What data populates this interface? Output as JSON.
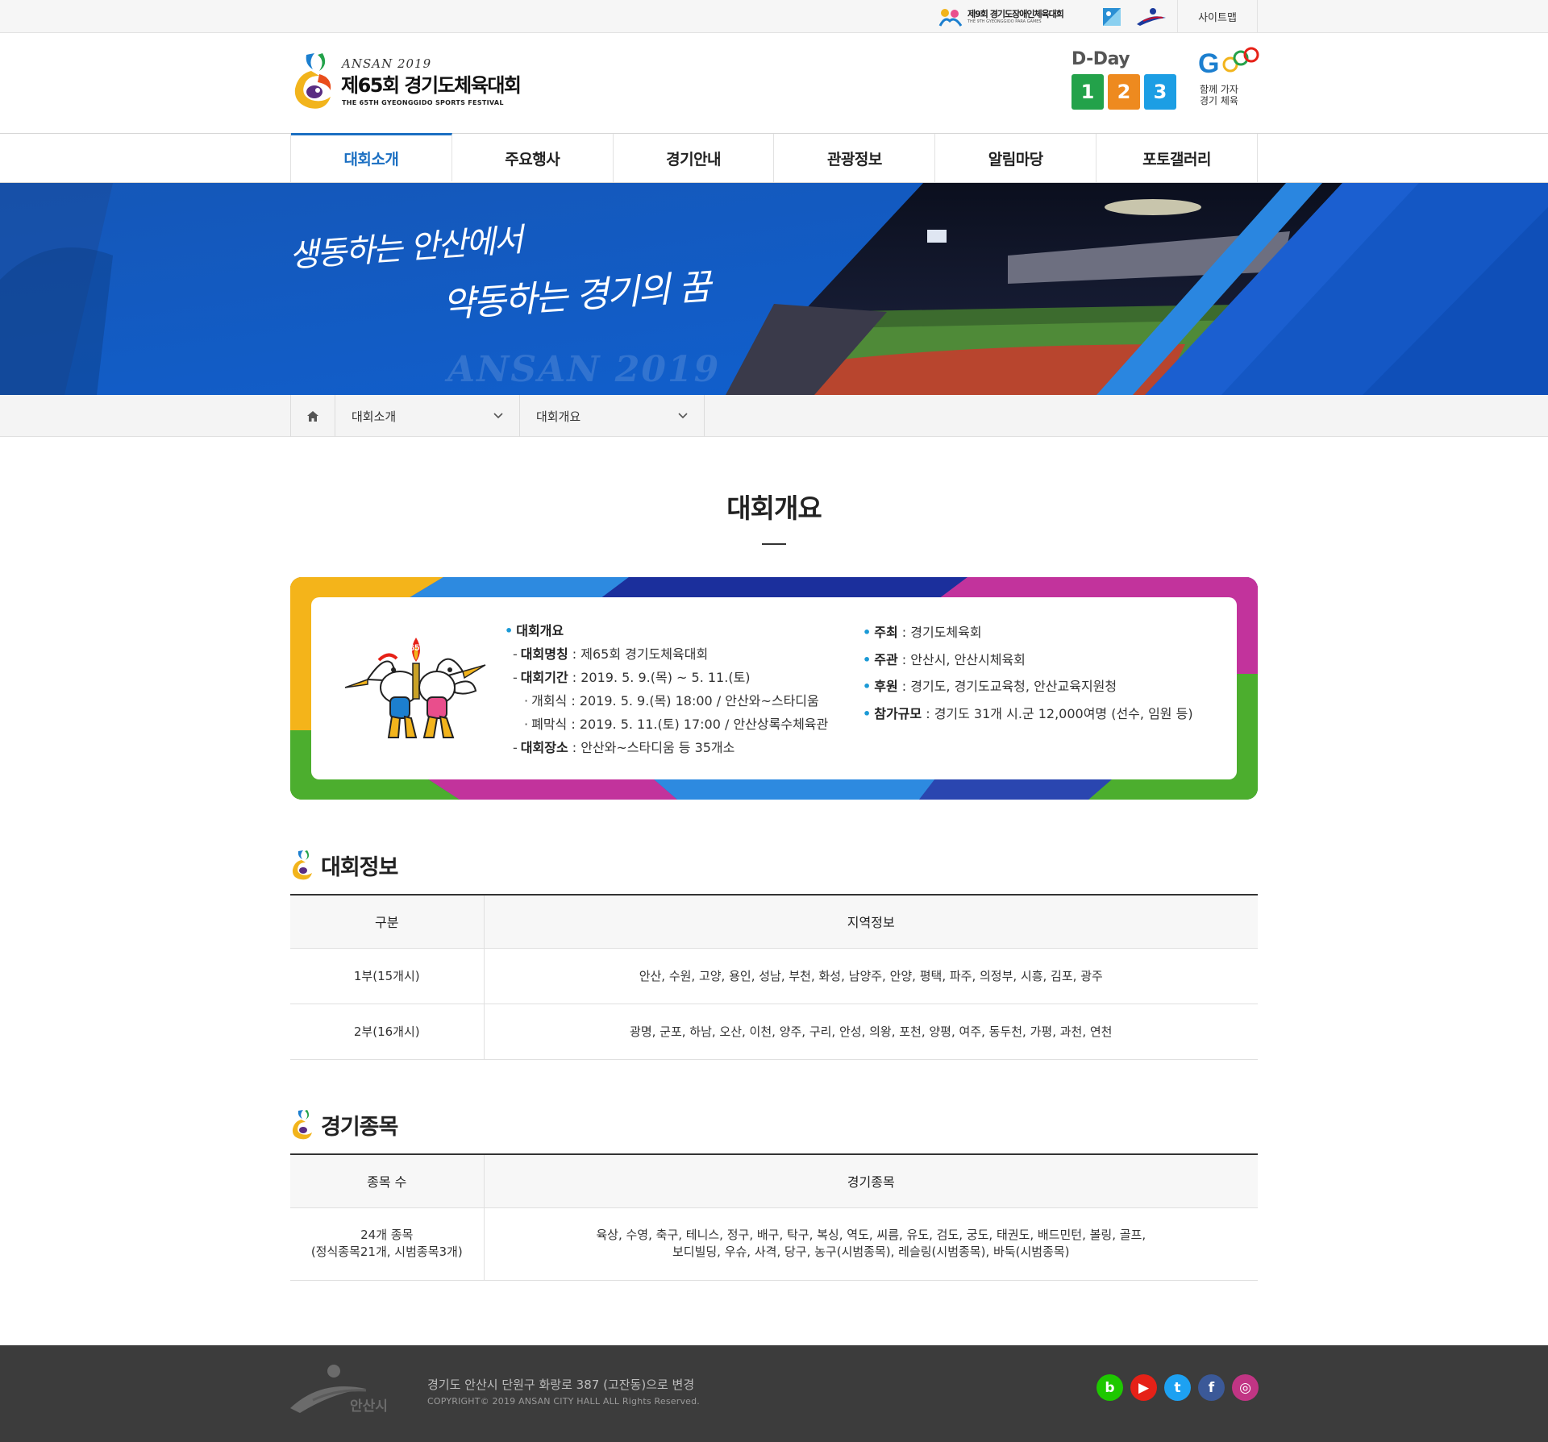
{
  "topbar": {
    "para_games_title": "제9회 경기도장애인체육대회",
    "para_games_subtitle": "THE 9TH GYEONGGIDO PARA GAMES",
    "sitemap_label": "사이트맵"
  },
  "header": {
    "logo_year": "ANSAN 2019",
    "logo_title": "제65회 경기도체육대회",
    "logo_subtitle": "THE 65TH GYEONGGIDO SPORTS FESTIVAL",
    "dday_label": "D-Day",
    "dday_digits": [
      "1",
      "2",
      "3"
    ],
    "dday_colors": [
      "#23a24a",
      "#ee8a1f",
      "#1c9ee4"
    ],
    "go_logo": "GO",
    "go_slogan_line1": "함께 가자",
    "go_slogan_line2": "경기 체육"
  },
  "nav": {
    "items": [
      "대회소개",
      "주요행사",
      "경기안내",
      "관광정보",
      "알림마당",
      "포토갤러리"
    ],
    "active_index": 0,
    "accent_color": "#1b6fc2"
  },
  "hero": {
    "slogan_line1": "생동하는 안산에서",
    "slogan_line2": "약동하는 경기의 꿈",
    "watermark": "ANSAN 2019"
  },
  "breadcrumb": {
    "home_icon": "home-icon",
    "level1": "대회소개",
    "level2": "대회개요"
  },
  "page_title": "대회개요",
  "overview": {
    "heading": "대회개요",
    "name_label": "대회명칭",
    "name_value": " : 제65회 경기도체육대회",
    "period_label": "대회기간",
    "period_value": " : 2019. 5. 9.(목) ~ 5. 11.(토)",
    "opening": "개회식 : 2019. 5. 9.(목) 18:00 / 안산와~스타디움",
    "closing": "폐막식 : 2019. 5. 11.(토) 17:00 / 안산상록수체육관",
    "venue_label": "대회장소",
    "venue_value": " : 안산와~스타디움 등 35개소",
    "host_label": "주최",
    "host_value": " : 경기도체육회",
    "organizer_label": "주관",
    "organizer_value": " : 안산시, 안산시체육회",
    "sponsor_label": "후원",
    "sponsor_value": " : 경기도, 경기도교육청, 안산교육지원청",
    "scale_label": "참가규모",
    "scale_value": " : 경기도 31개 시.군 12,000여명 (선수, 임원 등)"
  },
  "info_section": {
    "title": "대회정보",
    "headers": [
      "구분",
      "지역정보"
    ],
    "rows": [
      [
        "1부(15개시)",
        "안산, 수원, 고양, 용인, 성남, 부천, 화성, 남양주, 안양, 평택, 파주, 의정부, 시흥, 김포, 광주"
      ],
      [
        "2부(16개시)",
        "광명, 군포, 하남, 오산, 이천, 양주, 구리, 안성, 의왕, 포천, 양평, 여주, 동두천, 가평, 과천, 연천"
      ]
    ]
  },
  "sports_section": {
    "title": "경기종목",
    "headers": [
      "종목 수",
      "경기종목"
    ],
    "count_line1": "24개 종목",
    "count_line2": "(정식종목21개, 시범종목3개)",
    "sports_line1": "육상, 수영, 축구, 테니스, 정구, 배구, 탁구, 복싱, 역도, 씨름, 유도, 검도, 궁도, 태권도, 배드민턴, 볼링, 골프,",
    "sports_line2": "보디빌딩, 우슈, 사격, 당구, 농구(시범종목), 레슬링(시범종목), 바둑(시범종목)"
  },
  "footer": {
    "city_name": "안산시",
    "address": "경기도 안산시 단원구 화랑로 387 (고잔동)으로 변경",
    "copyright": "COPYRIGHT© 2019 ANSAN CITY HALL ALL Rights Reserved.",
    "social": [
      {
        "name": "blog-icon",
        "glyph": "b",
        "color": "#1ec800"
      },
      {
        "name": "youtube-icon",
        "glyph": "▶",
        "color": "#e62117"
      },
      {
        "name": "twitter-icon",
        "glyph": "t",
        "color": "#1da1f2"
      },
      {
        "name": "facebook-icon",
        "glyph": "f",
        "color": "#3b5998"
      },
      {
        "name": "instagram-icon",
        "glyph": "◎",
        "color": "#c13584"
      }
    ]
  }
}
